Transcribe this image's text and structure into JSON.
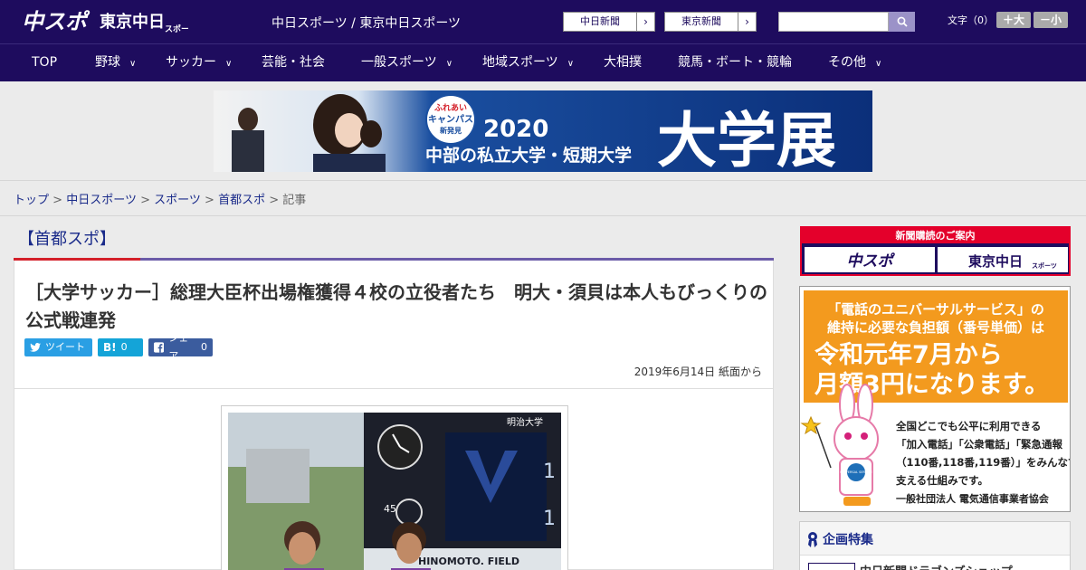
{
  "header": {
    "logo_chuspo": "中スポ",
    "logo_tokyo": "東京中日スポーツ",
    "site_title": "中日スポーツ / 東京中日スポーツ",
    "ext_links": [
      {
        "label": "中日新聞",
        "arrow": "›"
      },
      {
        "label": "東京新聞",
        "arrow": "›"
      }
    ],
    "search": {
      "value": "",
      "placeholder": "",
      "icon": "search-icon"
    },
    "font_size": {
      "label": "文字（0）",
      "plus": "＋大",
      "minus": "－小"
    }
  },
  "nav": {
    "items": [
      {
        "label": "TOP",
        "dropdown": false
      },
      {
        "label": "野球",
        "dropdown": true
      },
      {
        "label": "サッカー",
        "dropdown": true
      },
      {
        "label": "芸能・社会",
        "dropdown": false
      },
      {
        "label": "一般スポーツ",
        "dropdown": true
      },
      {
        "label": "地域スポーツ",
        "dropdown": true
      },
      {
        "label": "大相撲",
        "dropdown": false
      },
      {
        "label": "競馬・ボート・競輪",
        "dropdown": false
      },
      {
        "label": "その他",
        "dropdown": true
      }
    ],
    "chevron": "∨"
  },
  "banner": {
    "badge_line1": "ふれあい",
    "badge_line2": "キャンパス",
    "badge_line3": "新発見",
    "year": "2020",
    "subtitle": "中部の私立大学・短期大学",
    "title": "大学展"
  },
  "breadcrumb": {
    "items": [
      "トップ",
      "中日スポーツ",
      "スポーツ",
      "首都スポ"
    ],
    "current": "記事",
    "sep": ">"
  },
  "section": {
    "heading": "【首都スポ】"
  },
  "article": {
    "title": "［大学サッカー］総理大臣杯出場権獲得４校の立役者たち　明大・須貝は本人もびっくりの公式戦連発",
    "share": {
      "tweet": "ツイート",
      "hatena": "B!",
      "hatena_count": "0",
      "facebook": "シェア",
      "facebook_count": "0"
    },
    "date": "2019年6月14日 紙面から",
    "photo": {
      "scoreboard_team": "明治大学",
      "score_top": "1",
      "score_bottom": "1",
      "clock_label": "45",
      "field_sign": "HINOMOTO. FIELD"
    }
  },
  "sidebar": {
    "subscribe": {
      "heading": "新聞購読のご案内",
      "logo1": "中スポ",
      "logo2": "東京中日",
      "logo2_small": "スポーツ"
    },
    "ad": {
      "line1": "「電話のユニバーサルサービス」の",
      "line2": "維持に必要な負担額（番号単価）は",
      "line3": "令和元年7月から",
      "line4": "月額3円になります。",
      "body1": "全国どこでも公平に利用できる",
      "body2": "「加入電話」「公衆電話」「緊急通報",
      "body3": "（110番,118番,119番）」をみんなで",
      "body4": "支える仕組みです。",
      "org": "一般社団法人 電気通信事業者協会",
      "mascot_badge": "UNIVERSAL SERVICE"
    },
    "feature": {
      "title": "企画特集",
      "item": "中日新聞ドラゴンズショップ"
    }
  },
  "colors": {
    "header_bg": "#1e0c5e",
    "accent_red": "#d4202a",
    "link": "#1a2b8a",
    "ad_orange": "#f39a1e"
  }
}
